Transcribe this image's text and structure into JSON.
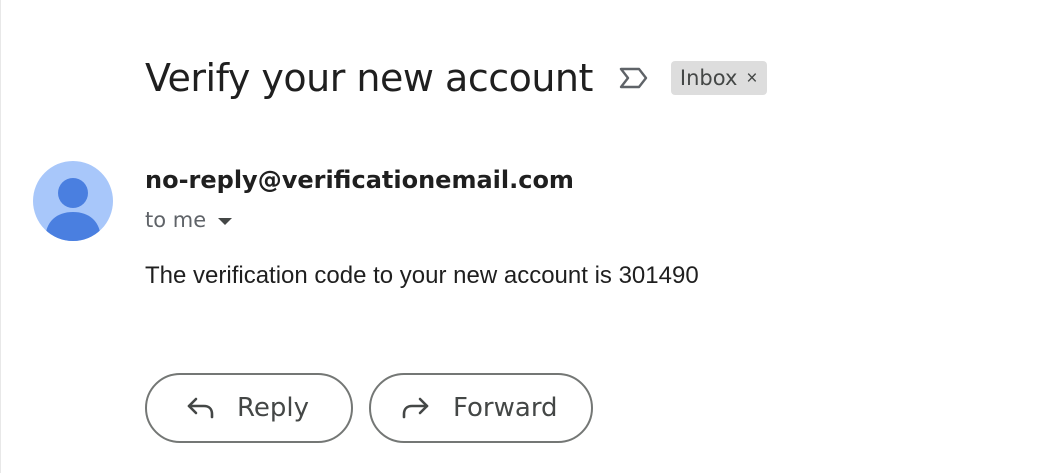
{
  "email": {
    "subject": "Verify your new account",
    "label": {
      "name": "Inbox",
      "remove_glyph": "×"
    },
    "sender": "no-reply@verificationemail.com",
    "recipient": "to me",
    "body": "The verification code to your new account is 301490"
  },
  "actions": {
    "reply_label": "Reply",
    "forward_label": "Forward"
  },
  "icons": {
    "important": "important-marker-icon",
    "avatar": "person-avatar-icon",
    "reply": "reply-arrow-icon",
    "forward": "forward-arrow-icon",
    "details": "chevron-down-icon"
  },
  "colors": {
    "avatar_bg": "#a8c7fa",
    "avatar_fg": "#4a7fe0",
    "chip_bg": "#dddddd",
    "button_border": "#747775"
  }
}
